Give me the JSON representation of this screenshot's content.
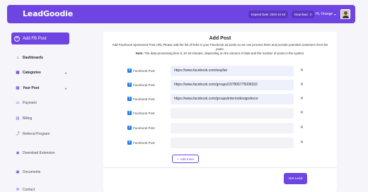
{
  "header": {
    "logo": "LeadGoodie",
    "expired_date": "Expired Date: 2024-10-18",
    "download": "Download : 0",
    "greeting": "Hi, Orange",
    "caret": "▾"
  },
  "sidebar": {
    "add_button": "Add FB Post",
    "items": [
      {
        "label": "Dashboards",
        "icon": "home-icon",
        "active": true
      },
      {
        "label": "Categories",
        "icon": "grid-icon",
        "active": true,
        "expandable": true
      },
      {
        "label": "Your Post",
        "icon": "document-icon",
        "active": true,
        "expandable": true
      },
      {
        "label": "Payment",
        "icon": "card-icon"
      },
      {
        "label": "Billing",
        "icon": "bill-icon"
      },
      {
        "label": "Referral Program",
        "icon": "share-icon"
      },
      {
        "label": "Download Extension",
        "icon": "extension-icon"
      },
      {
        "label": "Documents",
        "icon": "docs-icon"
      },
      {
        "label": "Contact",
        "icon": "contact-icon"
      }
    ]
  },
  "form": {
    "title": "Add Post",
    "description": "Add Facebook Sponsored Post URL Please add the list of links to your Facebook ad posts so we can process them and provide potential customers from the posts.",
    "note_label": "Note:",
    "note_text": "The data processing time is 10-15 minutes, depending on the amount of data and the number of posts in the system.",
    "row_label": "Facebook Post",
    "rows": [
      {
        "value": "https://www.facebook.com/wayfair"
      },
      {
        "value": "https://www.facebook.com/groups/197806775006332"
      },
      {
        "value": "https://www.facebook.com/groups/interiordesigndecor"
      },
      {
        "value": ""
      },
      {
        "value": ""
      },
      {
        "value": ""
      }
    ],
    "remove_symbol": "✕",
    "add_more": "Add more",
    "submit": "Get Lead"
  },
  "colors": {
    "accent": "#6e45e2",
    "facebook": "#1877f2"
  }
}
